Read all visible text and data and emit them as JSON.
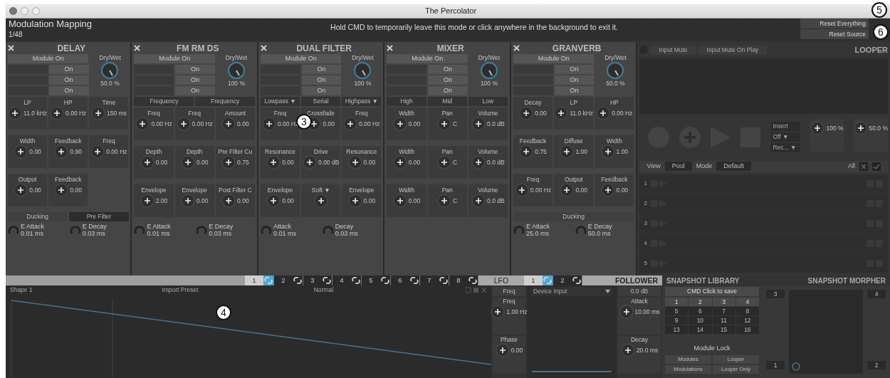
{
  "window": {
    "title": "The Percolator"
  },
  "header": {
    "title": "Modulation Mapping",
    "counter": "1/48",
    "message": "Hold CMD to temporarily leave this mode or click anywhere in the background to exit it.",
    "buttons": [
      "Reset Everything",
      "Reset Source"
    ]
  },
  "devices": [
    {
      "title": "DELAY",
      "module_on": "Module On",
      "switches": [
        "On",
        "On",
        "On"
      ],
      "drywet": {
        "label": "Dry/Wet",
        "value": "50.0 %"
      },
      "knobs": [
        {
          "label": "LP",
          "value": "11.0 kHz"
        },
        {
          "label": "HP",
          "value": "0.00 Hz"
        },
        {
          "label": "Time",
          "value": "150 ms"
        },
        {
          "label": "Width",
          "value": "0.00"
        },
        {
          "label": "Feedback",
          "value": "0.90"
        },
        {
          "label": "Freq",
          "value": "0.00 Hz"
        },
        {
          "label": "Output",
          "value": "0.00"
        },
        {
          "label": "Feedback",
          "value": "0.00"
        }
      ],
      "toggles": [
        "Ducking",
        "Pre Filter"
      ],
      "envelopes": [
        {
          "label": "E Attack",
          "value": "0.01 ms"
        },
        {
          "label": "E Decay",
          "value": "0.03 ms"
        }
      ]
    },
    {
      "title": "FM RM DS",
      "module_on": "Module On",
      "switches": [
        "On",
        "On",
        "On"
      ],
      "drywet": {
        "label": "Dry/Wet",
        "value": "100 %"
      },
      "selectors": [
        "Frequency",
        "Frequency"
      ],
      "knobs": [
        {
          "label": "Freq",
          "value": "0.00 Hz"
        },
        {
          "label": "Freq",
          "value": "0.00 Hz"
        },
        {
          "label": "Amount",
          "value": "0.00"
        },
        {
          "label": "Depth",
          "value": "0.00"
        },
        {
          "label": "Depth",
          "value": "0.00"
        },
        {
          "label": "Pre Filter Cu",
          "value": "0.75"
        },
        {
          "label": "Envelope",
          "value": "2.00"
        },
        {
          "label": "Envelope",
          "value": "0.00"
        },
        {
          "label": "Post Filter C",
          "value": "0.00"
        }
      ],
      "envelopes": [
        {
          "label": "E Attack",
          "value": "0.01 ms"
        },
        {
          "label": "E Decay",
          "value": "0.03 ms"
        }
      ]
    },
    {
      "title": "DUAL FILTER",
      "module_on": "Module On",
      "switches": [
        "On",
        "On",
        "On"
      ],
      "drywet": {
        "label": "Dry/Wet",
        "value": "100 %"
      },
      "selectors": [
        "Lowpass ▼",
        "Serial",
        "Highpass ▼"
      ],
      "knobs": [
        {
          "label": "Freq",
          "value": "0.00 Hz"
        },
        {
          "label": "Crossfade",
          "value": "0.00"
        },
        {
          "label": "Freq",
          "value": "0.00 Hz"
        },
        {
          "label": "Resonance",
          "value": "0.00"
        },
        {
          "label": "Drive",
          "value": "0.00 dB"
        },
        {
          "label": "Resonance",
          "value": "0.00"
        },
        {
          "label": "Envelope",
          "value": "0.00"
        },
        {
          "label": "Soft ▼"
        },
        {
          "label": "Envelope",
          "value": "0.00"
        }
      ],
      "envelopes": [
        {
          "label": "Attack",
          "value": "0.01 ms"
        },
        {
          "label": "Decay",
          "value": "0.03 ms"
        }
      ]
    },
    {
      "title": "MIXER",
      "module_on": "Module On",
      "switches": [
        "On",
        "On",
        "On"
      ],
      "drywet": {
        "label": "Dry/Wet",
        "value": "100 %"
      },
      "selectors": [
        "High",
        "Mid",
        "Low"
      ],
      "knobs": [
        {
          "label": "Width",
          "value": "0.00"
        },
        {
          "label": "Pan",
          "value": "C"
        },
        {
          "label": "Volume",
          "value": "0.0 dB"
        },
        {
          "label": "Width",
          "value": "0.00"
        },
        {
          "label": "Pan",
          "value": "C"
        },
        {
          "label": "Volume",
          "value": "0.0 dB"
        },
        {
          "label": "Width",
          "value": "0.00"
        },
        {
          "label": "Pan",
          "value": "C"
        },
        {
          "label": "Volume",
          "value": "0.0 dB"
        }
      ]
    },
    {
      "title": "GRANVERB",
      "module_on": "Module On",
      "switches": [
        "On",
        "On",
        "On"
      ],
      "drywet": {
        "label": "Dry/Wet",
        "value": "50.0 %"
      },
      "knobs": [
        {
          "label": "Decay",
          "value": "0.00"
        },
        {
          "label": "LP",
          "value": "11.0 kHz"
        },
        {
          "label": "HP",
          "value": "0.00 Hz"
        },
        {
          "label": "Feedback",
          "value": "0.75"
        },
        {
          "label": "Diffuse",
          "value": "1.00"
        },
        {
          "label": "Width",
          "value": "1.00"
        },
        {
          "label": "Freq",
          "value": "0.00 Hz"
        },
        {
          "label": "Output",
          "value": "0.00"
        },
        {
          "label": "Feedback",
          "value": "0.00"
        }
      ],
      "toggles": [
        "Ducking"
      ],
      "envelopes": [
        {
          "label": "E Attack",
          "value": "25.0 ms"
        },
        {
          "label": "E Decay",
          "value": "50.0 ms"
        }
      ]
    }
  ],
  "looper": {
    "title": "LOOPER",
    "buttons": [
      "Input Mute",
      "Input Mute On Play"
    ],
    "dropdowns": [
      "Insert",
      "Off ▼",
      "Rec... ▼"
    ],
    "knob_values": [
      "100 %",
      "50.0 %"
    ],
    "view_label": "View",
    "view_value": "Pool",
    "mode_label": "Mode",
    "mode_value": "Default",
    "all_label": "All",
    "slots": [
      "1",
      "2",
      "3",
      "4",
      "5"
    ]
  },
  "mod_tabs": [
    {
      "label": "1",
      "selected": true
    },
    {
      "label": "2",
      "selected": false
    },
    {
      "label": "3",
      "selected": false
    },
    {
      "label": "4",
      "selected": false
    },
    {
      "label": "5",
      "selected": false
    },
    {
      "label": "6",
      "selected": false
    },
    {
      "label": "7",
      "selected": false
    },
    {
      "label": "8",
      "selected": false
    }
  ],
  "lfo_label": "LFO",
  "follower_tabs": [
    {
      "label": "1",
      "selected": true
    },
    {
      "label": "2",
      "selected": false
    }
  ],
  "follower_label": "FOLLOWER",
  "lfo": {
    "shape": "Shape 1",
    "preset": "Import Preset",
    "mode": "Normal",
    "rate_button": "Freq",
    "knobs": [
      {
        "label": "Freq",
        "value": "1.00 Hz"
      },
      {
        "label": "Phase",
        "value": "0.00"
      }
    ]
  },
  "follower": {
    "input": "Device Input",
    "gain": "0.0 dB",
    "knobs": [
      {
        "label": "Attack",
        "value": "10.00 ms"
      },
      {
        "label": "Decay",
        "value": "20.0 ms"
      }
    ]
  },
  "snapshot_library": {
    "title": "SNAPSHOT LIBRARY",
    "hint": "CMD Click to save",
    "slots": [
      "1",
      "2",
      "3",
      "4",
      "5",
      "6",
      "7",
      "8",
      "9",
      "10",
      "11",
      "12",
      "13",
      "14",
      "15",
      "16"
    ],
    "lock_title": "Module Lock",
    "lock_buttons": [
      "Modules",
      "Looper",
      "Modulations",
      "Looper Only"
    ]
  },
  "snapshot_morpher": {
    "title": "SNAPSHOT MORPHER",
    "corners": [
      "3",
      "4",
      "1",
      "2"
    ]
  },
  "callouts": [
    "3",
    "4",
    "5",
    "6"
  ]
}
